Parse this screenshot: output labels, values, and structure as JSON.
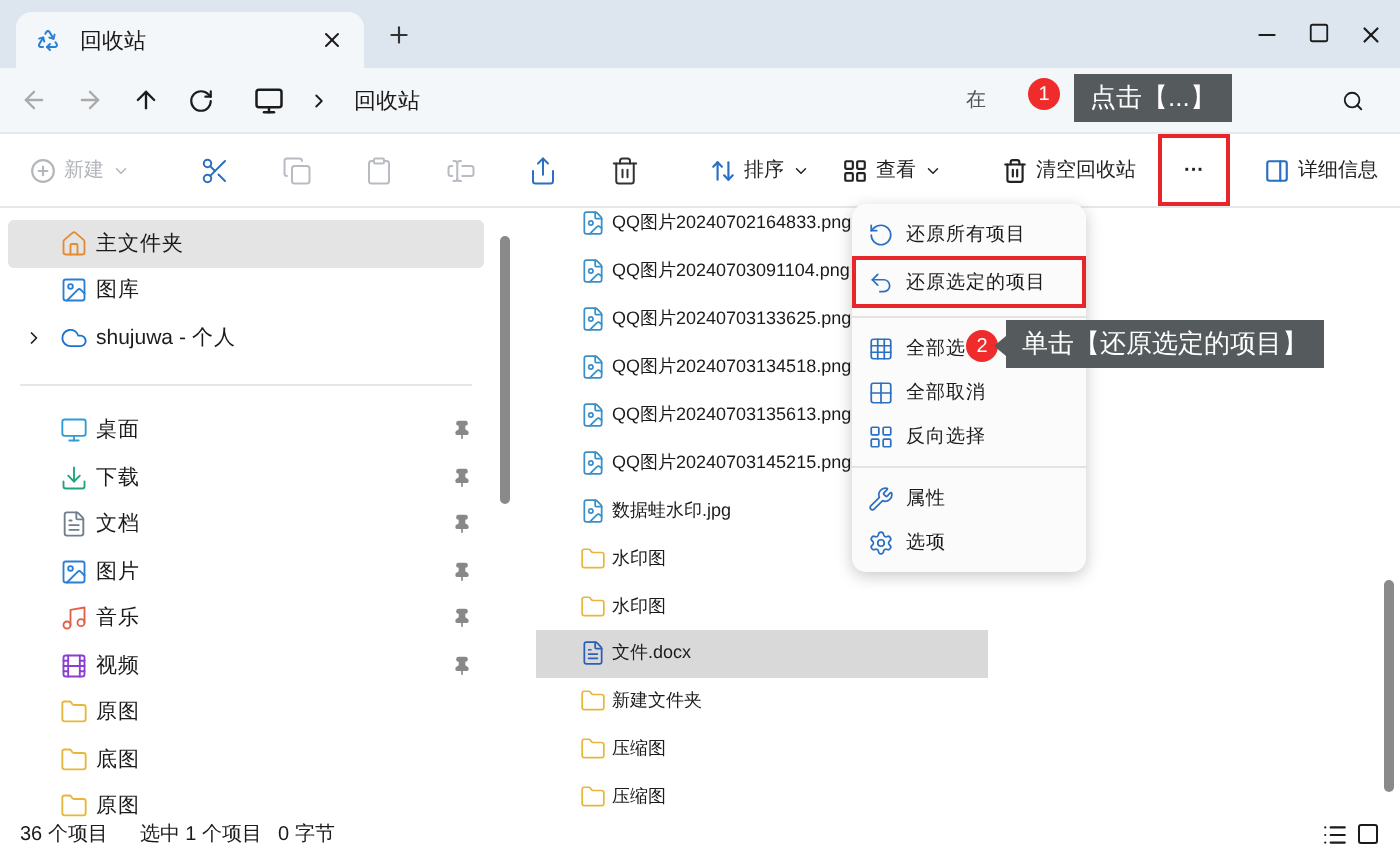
{
  "tabs": [
    {
      "label": "回收站",
      "selected": true
    }
  ],
  "address": {
    "path": [
      "回收站"
    ]
  },
  "search": {
    "placeholder": "在"
  },
  "toolbar": {
    "new_button": {
      "label": "新建",
      "disabled": true
    },
    "icon_buttons": [
      {
        "kind": "cut",
        "disabled": false
      },
      {
        "kind": "copy",
        "disabled": true
      },
      {
        "kind": "paste",
        "disabled": true
      },
      {
        "kind": "rename",
        "disabled": true
      },
      {
        "kind": "share",
        "disabled": false
      },
      {
        "kind": "delete",
        "disabled": false
      }
    ],
    "sort_button": {
      "label": "排序"
    },
    "view_button": {
      "label": "查看"
    },
    "empty_button": {
      "label": "清空回收站"
    },
    "more_button": {
      "label": "···",
      "annotated": true
    },
    "details_button": {
      "label": "详细信息"
    }
  },
  "sidebar": {
    "items": [
      {
        "kind": "home",
        "label": "主文件夹",
        "selected": true,
        "pinned": false,
        "expandable": false
      },
      {
        "kind": "gallery",
        "label": "图库",
        "selected": false,
        "pinned": false,
        "expandable": false
      },
      {
        "kind": "cloud",
        "label": "shujuwa - 个人",
        "selected": false,
        "pinned": false,
        "expandable": true
      },
      {
        "kind": "divider"
      },
      {
        "kind": "desktop",
        "label": "桌面",
        "selected": false,
        "pinned": true,
        "expandable": false
      },
      {
        "kind": "download",
        "label": "下载",
        "selected": false,
        "pinned": true,
        "expandable": false
      },
      {
        "kind": "documents",
        "label": "文档",
        "selected": false,
        "pinned": true,
        "expandable": false
      },
      {
        "kind": "pictures",
        "label": "图片",
        "selected": false,
        "pinned": true,
        "expandable": false
      },
      {
        "kind": "music",
        "label": "音乐",
        "selected": false,
        "pinned": true,
        "expandable": false
      },
      {
        "kind": "videos",
        "label": "视频",
        "selected": false,
        "pinned": true,
        "expandable": false
      },
      {
        "kind": "folder",
        "label": "原图",
        "selected": false,
        "pinned": false,
        "expandable": false
      },
      {
        "kind": "folder",
        "label": "底图",
        "selected": false,
        "pinned": false,
        "expandable": false
      },
      {
        "kind": "folder",
        "label": "原图",
        "selected": false,
        "pinned": false,
        "expandable": false
      }
    ]
  },
  "files": [
    {
      "kind": "image",
      "name": "QQ图片20240702164833.png",
      "selected": false
    },
    {
      "kind": "image",
      "name": "QQ图片20240703091104.png",
      "selected": false
    },
    {
      "kind": "image",
      "name": "QQ图片20240703133625.png",
      "selected": false
    },
    {
      "kind": "image",
      "name": "QQ图片20240703134518.png",
      "selected": false
    },
    {
      "kind": "image",
      "name": "QQ图片20240703135613.png",
      "selected": false
    },
    {
      "kind": "image",
      "name": "QQ图片20240703145215.png",
      "selected": false
    },
    {
      "kind": "image",
      "name": "数据蛙水印.jpg",
      "selected": false
    },
    {
      "kind": "folder",
      "name": "水印图",
      "selected": false
    },
    {
      "kind": "folder",
      "name": "水印图",
      "selected": false
    },
    {
      "kind": "word",
      "name": "文件.docx",
      "selected": true
    },
    {
      "kind": "folder",
      "name": "新建文件夹",
      "selected": false
    },
    {
      "kind": "folder",
      "name": "压缩图",
      "selected": false
    },
    {
      "kind": "folder",
      "name": "压缩图",
      "selected": false
    }
  ],
  "context_menu": {
    "items": [
      {
        "kind": "restore-all",
        "label": "还原所有项目",
        "annotated": false
      },
      {
        "kind": "restore-selected",
        "label": "还原选定的项目",
        "annotated": true
      },
      {
        "kind": "divider"
      },
      {
        "kind": "select-all",
        "label": "全部选",
        "annotated": false
      },
      {
        "kind": "select-none",
        "label": "全部取消",
        "annotated": false
      },
      {
        "kind": "invert",
        "label": "反向选择",
        "annotated": false
      },
      {
        "kind": "divider"
      },
      {
        "kind": "properties",
        "label": "属性",
        "annotated": false
      },
      {
        "kind": "options",
        "label": "选项",
        "annotated": false
      }
    ]
  },
  "callouts": [
    {
      "number": "1",
      "text": "点击【...】"
    },
    {
      "number": "2",
      "text": "单击【还原选定的项目】"
    }
  ],
  "status_bar": {
    "count": "36 个项目",
    "selection": "选中 1 个项目",
    "size": "0 字节"
  }
}
